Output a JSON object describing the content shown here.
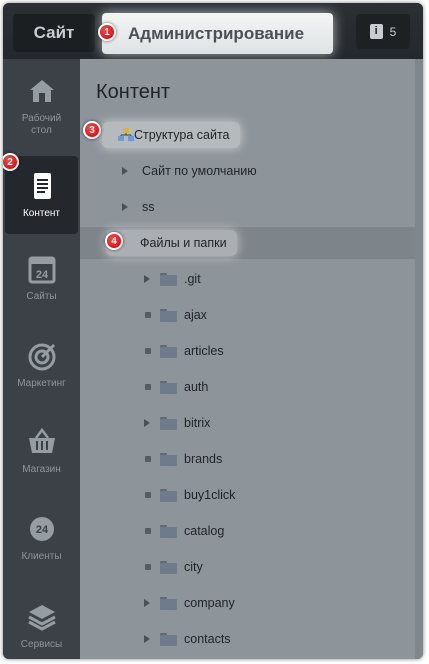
{
  "topbar": {
    "site_tab": "Сайт",
    "admin_tab": "Администрирование",
    "notifications_count": "5",
    "notifications_icon": "i"
  },
  "markers": [
    "1",
    "2",
    "3",
    "4"
  ],
  "sidebar": {
    "items": [
      {
        "label": "Рабочий стол",
        "icon": "home-icon"
      },
      {
        "label": "Контент",
        "icon": "document-icon",
        "active": true
      },
      {
        "label": "Сайты",
        "icon": "calendar-24-icon"
      },
      {
        "label": "Маркетинг",
        "icon": "target-icon"
      },
      {
        "label": "Магазин",
        "icon": "basket-icon"
      },
      {
        "label": "Клиенты",
        "icon": "clients-24-icon"
      },
      {
        "label": "Сервисы",
        "icon": "layers-icon"
      }
    ]
  },
  "content": {
    "title": "Контент",
    "tree": {
      "structure": "Структура сайта",
      "default_site": "Сайт по умолчанию",
      "ss": "ss",
      "files_and_folders": "Файлы и папки",
      "folders": [
        ".git",
        "ajax",
        "articles",
        "auth",
        "bitrix",
        "brands",
        "buy1click",
        "catalog",
        "city",
        "company",
        "contacts"
      ]
    }
  },
  "colors": {
    "topbar": "#2c3035",
    "sidebar": "#3b4146",
    "panel": "#8e959a",
    "marker": "#d40000",
    "folder": "#6d7b8b"
  }
}
